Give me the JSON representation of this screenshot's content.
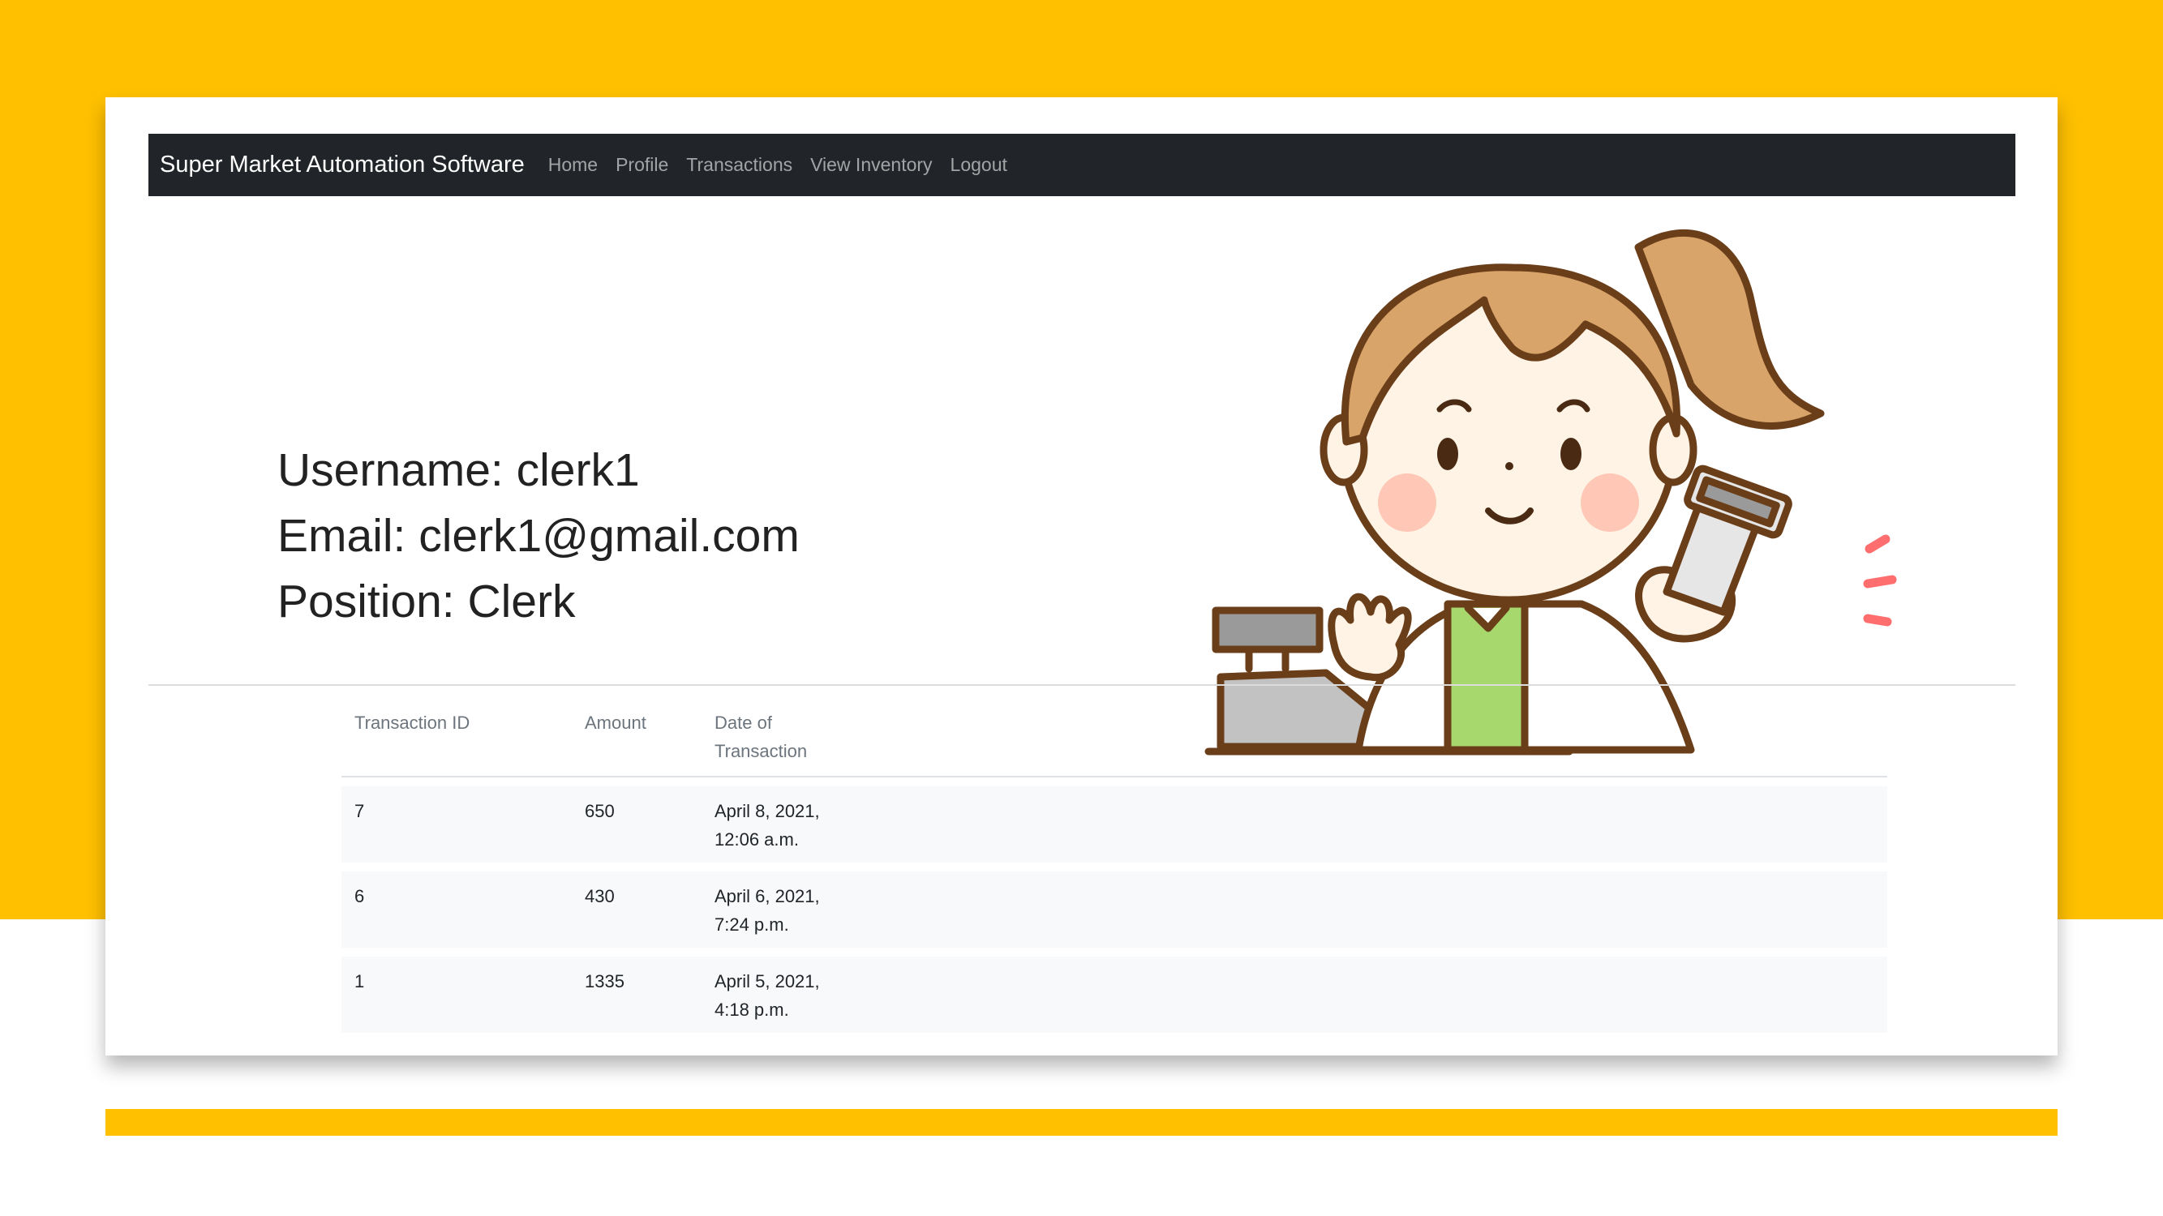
{
  "navbar": {
    "brand": "Super Market Automation Software",
    "items": [
      "Home",
      "Profile",
      "Transactions",
      "View Inventory",
      "Logout"
    ]
  },
  "profile": {
    "username_line": "Username: clerk1",
    "email_line": "Email: clerk1@gmail.com",
    "position_line": "Position: Clerk"
  },
  "table": {
    "headers": [
      "Transaction ID",
      "Amount",
      "Date of Transaction"
    ],
    "rows": [
      {
        "id": "7",
        "amount": "650",
        "date": "April 8, 2021, 12:06 a.m."
      },
      {
        "id": "6",
        "amount": "430",
        "date": "April 6, 2021, 7:24 p.m."
      },
      {
        "id": "1",
        "amount": "1335",
        "date": "April 5, 2021, 4:18 p.m."
      }
    ]
  },
  "colors": {
    "accent_yellow": "#FFC000",
    "navbar_bg": "#212529",
    "row_bg": "#f8f9fa",
    "apron_green": "#A7D86E",
    "hair": "#D9A46A",
    "outline_brown": "#6B3E1A"
  },
  "icons": {
    "illustration": "cashier-girl-with-register-and-barcode-scanner"
  }
}
